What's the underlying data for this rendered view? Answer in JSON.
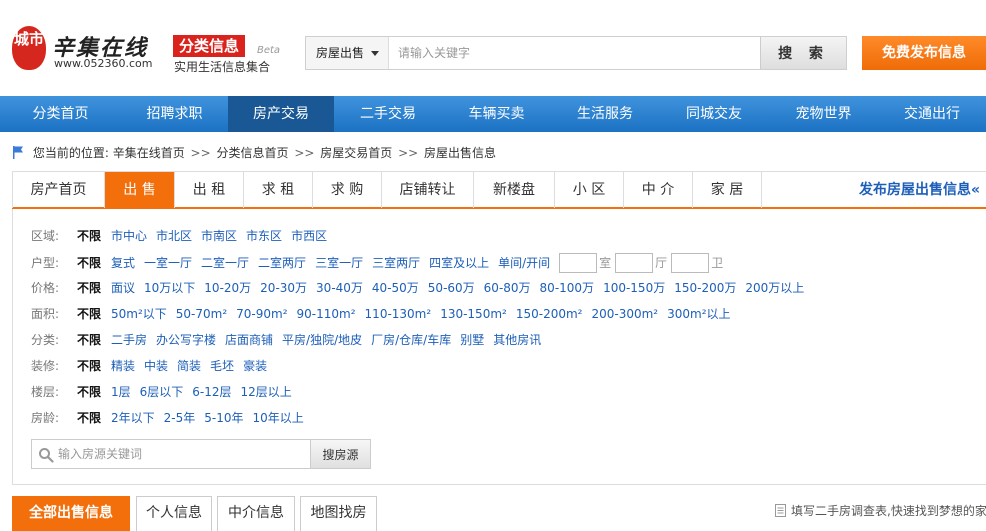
{
  "brand": {
    "seal_text": "城市",
    "name": "辛集在线",
    "url": "www.052360.com",
    "category_title": "分类信息",
    "beta": "Beta",
    "category_subtitle": "实用生活信息集合"
  },
  "search": {
    "type_selected": "房屋出售",
    "placeholder": "请输入关键字",
    "button": "搜 索"
  },
  "publish_button": "免费发布信息",
  "main_nav": [
    "分类首页",
    "招聘求职",
    "房产交易",
    "二手交易",
    "车辆买卖",
    "生活服务",
    "同城交友",
    "宠物世界",
    "交通出行"
  ],
  "breadcrumb": {
    "prefix": "您当前的位置:",
    "items": [
      "辛集在线首页",
      "分类信息首页",
      "房屋交易首页",
      "房屋出售信息"
    ],
    "separator": ">>"
  },
  "sub_tabs": [
    "房产首页",
    "出 售",
    "出 租",
    "求 租",
    "求 购",
    "店铺转让",
    "新楼盘",
    "小 区",
    "中 介",
    "家 居"
  ],
  "sub_publish_link": "发布房屋出售信息«",
  "filters": {
    "all_label": "不限",
    "rows": [
      {
        "label": "区域:",
        "options": [
          "市中心",
          "市北区",
          "市南区",
          "市东区",
          "市西区"
        ]
      },
      {
        "label": "户型:",
        "options": [
          "复式",
          "一室一厅",
          "二室一厅",
          "二室两厅",
          "三室一厅",
          "三室两厅",
          "四室及以上",
          "单间/开间"
        ]
      },
      {
        "label": "价格:",
        "options": [
          "面议",
          "10万以下",
          "10-20万",
          "20-30万",
          "30-40万",
          "40-50万",
          "50-60万",
          "60-80万",
          "80-100万",
          "100-150万",
          "150-200万",
          "200万以上"
        ]
      },
      {
        "label": "面积:",
        "options": [
          "50m²以下",
          "50-70m²",
          "70-90m²",
          "90-110m²",
          "110-130m²",
          "130-150m²",
          "150-200m²",
          "200-300m²",
          "300m²以上"
        ]
      },
      {
        "label": "分类:",
        "options": [
          "二手房",
          "办公写字楼",
          "店面商铺",
          "平房/独院/地皮",
          "厂房/仓库/车库",
          "别墅",
          "其他房讯"
        ]
      },
      {
        "label": "装修:",
        "options": [
          "精装",
          "中装",
          "简装",
          "毛坯",
          "豪装"
        ]
      },
      {
        "label": "楼层:",
        "options": [
          "1层",
          "6层以下",
          "6-12层",
          "12层以上"
        ]
      },
      {
        "label": "房龄:",
        "options": [
          "2年以下",
          "2-5年",
          "5-10年",
          "10年以上"
        ]
      }
    ],
    "room_units": [
      "室",
      "厅",
      "卫"
    ]
  },
  "keyword_search": {
    "placeholder": "输入房源关键词",
    "button": "搜房源"
  },
  "bottom_tabs": [
    "全部出售信息",
    "个人信息",
    "中介信息",
    "地图找房"
  ],
  "survey_text": "填写二手房调查表,快速找到梦想的家",
  "colors": {
    "accent_orange": "#f26f0c",
    "nav_blue": "#1c72c3",
    "link_blue": "#1d5fb8",
    "brand_red": "#d9231c"
  }
}
